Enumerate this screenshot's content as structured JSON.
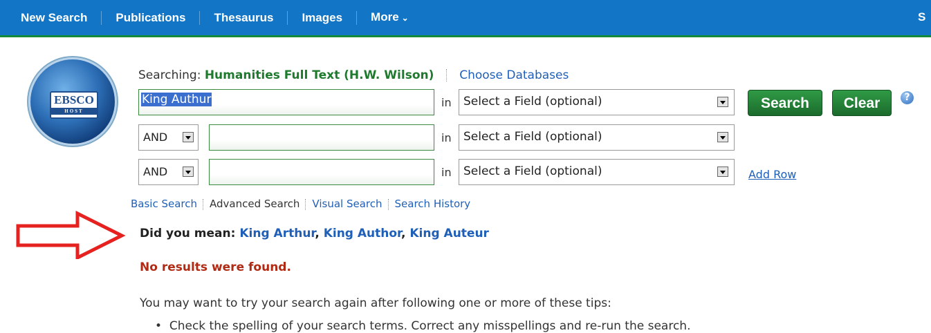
{
  "nav": {
    "items": [
      {
        "label": "New Search"
      },
      {
        "label": "Publications"
      },
      {
        "label": "Thesaurus"
      },
      {
        "label": "Images"
      },
      {
        "label": "More",
        "icon": "chevron-down-icon"
      }
    ],
    "right_label": "S",
    "bar_color": "#1375c5"
  },
  "logo": {
    "line1": "EBSCO",
    "line2": "HOST"
  },
  "searching": {
    "prefix": "Searching:",
    "database": "Humanities Full Text (H.W. Wilson)",
    "choose_link": "Choose Databases"
  },
  "rows": [
    {
      "bool": "",
      "value": "King Authur",
      "in": "in",
      "field": "Select a Field (optional)"
    },
    {
      "bool": "AND",
      "value": "",
      "in": "in",
      "field": "Select a Field (optional)"
    },
    {
      "bool": "AND",
      "value": "",
      "in": "in",
      "field": "Select a Field (optional)"
    }
  ],
  "buttons": {
    "search": "Search",
    "clear": "Clear",
    "help": "?",
    "add_row": "Add Row"
  },
  "search_links": [
    "Basic Search",
    "Advanced Search",
    "Visual Search",
    "Search History"
  ],
  "did_you_mean": {
    "prefix": "Did you mean:",
    "suggestions": [
      "King Arthur",
      "King Author",
      "King Auteur"
    ]
  },
  "no_results": "No results were found.",
  "tips": {
    "intro": "You may want to try your search again after following one or more of these tips:",
    "items": [
      "Check the spelling of your search terms. Correct any misspellings and re-run the search."
    ]
  },
  "colors": {
    "accent_green": "#1e7a2c",
    "link_blue": "#1f5fb8",
    "error_red": "#b02a14",
    "arrow_red": "#e5221f"
  }
}
